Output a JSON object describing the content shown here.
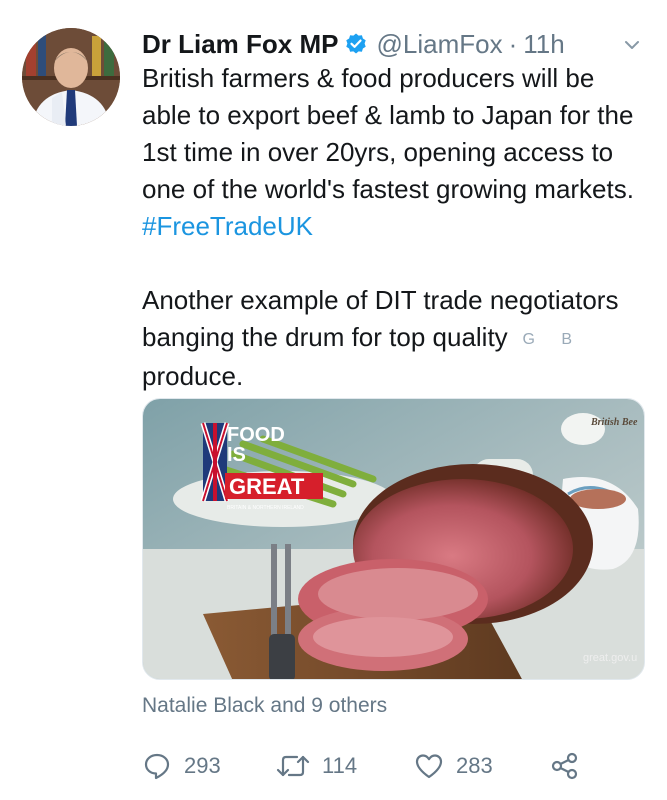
{
  "tweet": {
    "author_name": "Dr Liam Fox MP",
    "handle": "@LiamFox",
    "separator": "·",
    "time": "11h",
    "text_line_1": "British farmers & food producers will be able to export beef & lamb to Japan for the 1st time in over 20yrs, opening access to one of the world's fastest growing markets.",
    "hashtag": "#FreeTradeUK",
    "text_2_before": "Another example of DIT trade negotiators banging the drum for top quality",
    "flag_1": "G",
    "flag_2": "B",
    "text_2_after": "produce."
  },
  "media": {
    "badge_line_1": "FOOD",
    "badge_line_2": "IS",
    "badge_line_3": "GREAT",
    "badge_tagline": "BRITAIN & NORTHERN IRELAND",
    "corner_label": "British Bee",
    "watermark": "great.gov.u"
  },
  "likes": {
    "text": "Natalie Black and 9 others"
  },
  "actions": {
    "replies": "293",
    "retweets": "114",
    "likes": "283"
  },
  "colors": {
    "link": "#1b95e0",
    "secondary": "#657786",
    "verified": "#1da1f2"
  }
}
